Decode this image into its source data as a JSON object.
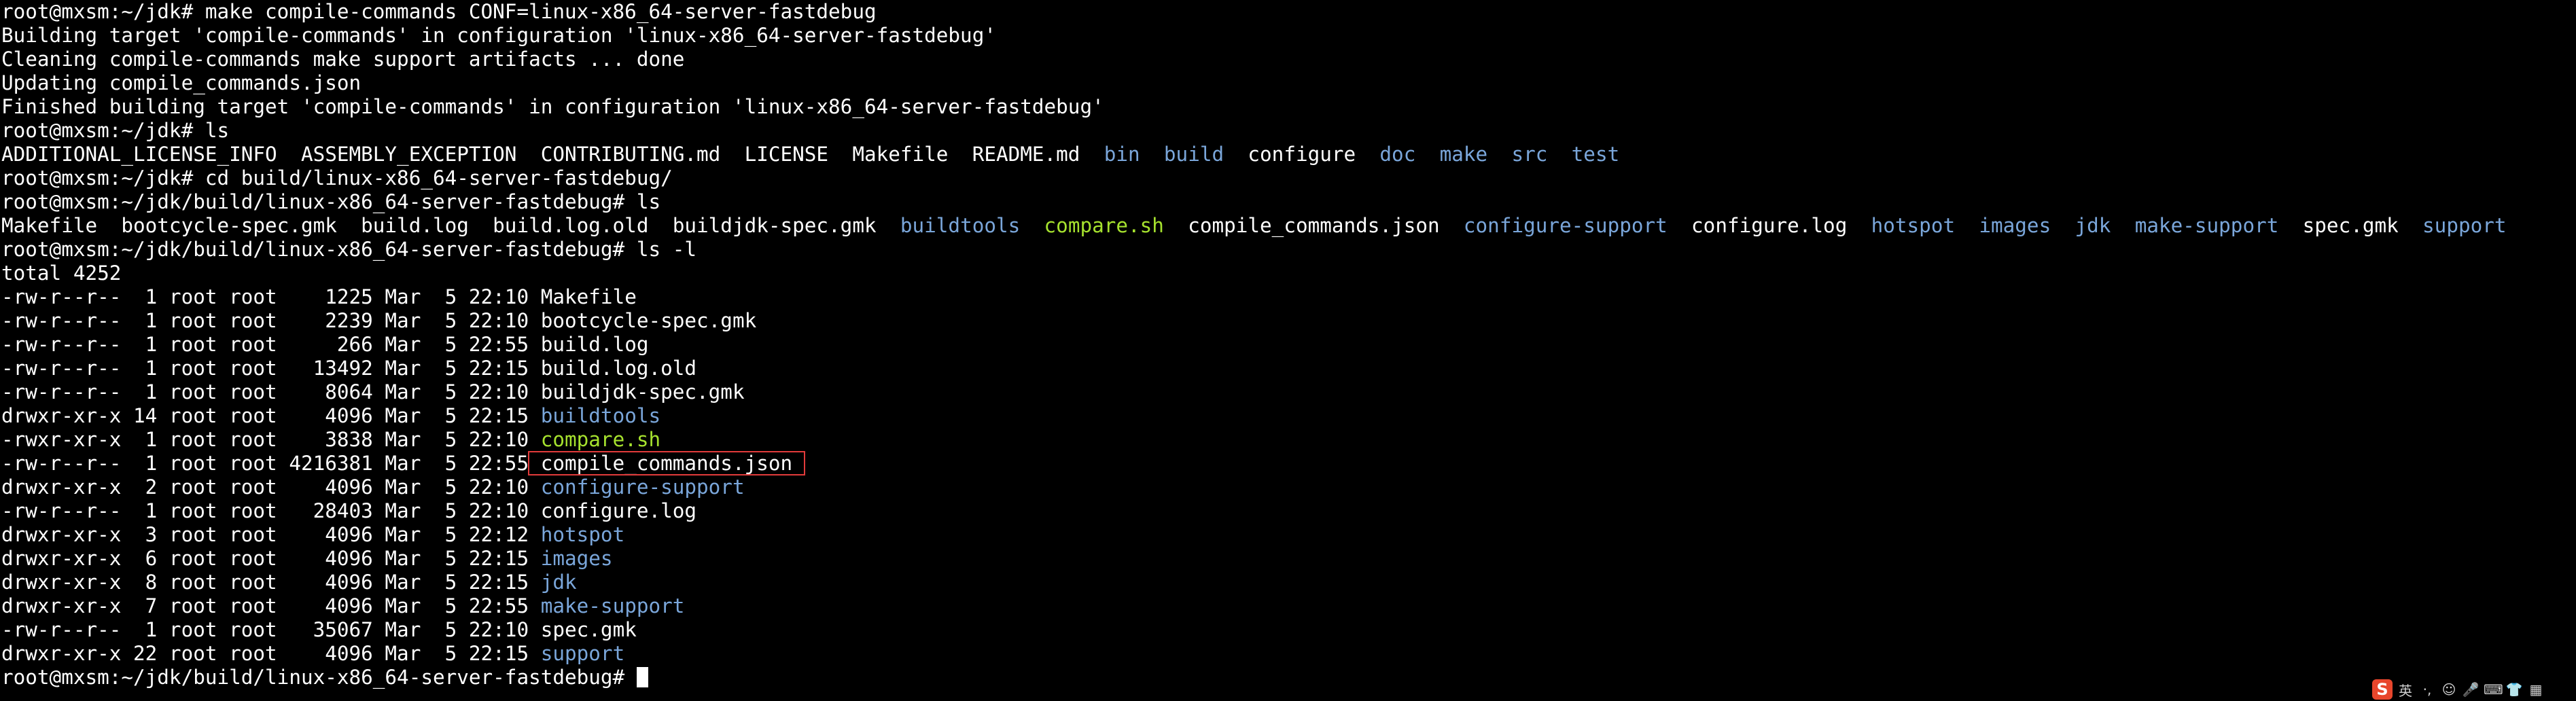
{
  "terminal": {
    "lines": [
      {
        "segments": [
          {
            "text": "root@mxsm:~/jdk# make compile-commands CONF=linux-x86_64-server-fastdebug",
            "kind": "plain"
          }
        ]
      },
      {
        "segments": [
          {
            "text": "Building target 'compile-commands' in configuration 'linux-x86_64-server-fastdebug'",
            "kind": "plain"
          }
        ]
      },
      {
        "segments": [
          {
            "text": "Cleaning compile-commands make support artifacts ... done",
            "kind": "plain"
          }
        ]
      },
      {
        "segments": [
          {
            "text": "Updating compile_commands.json",
            "kind": "plain"
          }
        ]
      },
      {
        "segments": [
          {
            "text": "Finished building target 'compile-commands' in configuration 'linux-x86_64-server-fastdebug'",
            "kind": "plain"
          }
        ]
      },
      {
        "segments": [
          {
            "text": "root@mxsm:~/jdk# ls",
            "kind": "plain"
          }
        ]
      },
      {
        "segments": [
          {
            "text": "ADDITIONAL_LICENSE_INFO  ASSEMBLY_EXCEPTION  CONTRIBUTING.md  LICENSE  Makefile  README.md  ",
            "kind": "plain"
          },
          {
            "text": "bin",
            "kind": "dir"
          },
          {
            "text": "  ",
            "kind": "plain"
          },
          {
            "text": "build",
            "kind": "dir"
          },
          {
            "text": "  configure  ",
            "kind": "plain"
          },
          {
            "text": "doc",
            "kind": "dir"
          },
          {
            "text": "  ",
            "kind": "plain"
          },
          {
            "text": "make",
            "kind": "dir"
          },
          {
            "text": "  ",
            "kind": "plain"
          },
          {
            "text": "src",
            "kind": "dir"
          },
          {
            "text": "  ",
            "kind": "plain"
          },
          {
            "text": "test",
            "kind": "dir"
          }
        ]
      },
      {
        "segments": [
          {
            "text": "root@mxsm:~/jdk# cd build/linux-x86_64-server-fastdebug/",
            "kind": "plain"
          }
        ]
      },
      {
        "segments": [
          {
            "text": "root@mxsm:~/jdk/build/linux-x86_64-server-fastdebug# ls",
            "kind": "plain"
          }
        ]
      },
      {
        "segments": [
          {
            "text": "Makefile  bootcycle-spec.gmk  build.log  build.log.old  buildjdk-spec.gmk  ",
            "kind": "plain"
          },
          {
            "text": "buildtools",
            "kind": "dir"
          },
          {
            "text": "  ",
            "kind": "plain"
          },
          {
            "text": "compare.sh",
            "kind": "exe"
          },
          {
            "text": "  compile_commands.json  ",
            "kind": "plain"
          },
          {
            "text": "configure-support",
            "kind": "dir"
          },
          {
            "text": "  configure.log  ",
            "kind": "plain"
          },
          {
            "text": "hotspot",
            "kind": "dir"
          },
          {
            "text": "  ",
            "kind": "plain"
          },
          {
            "text": "images",
            "kind": "dir"
          },
          {
            "text": "  ",
            "kind": "plain"
          },
          {
            "text": "jdk",
            "kind": "dir"
          },
          {
            "text": "  ",
            "kind": "plain"
          },
          {
            "text": "make-support",
            "kind": "dir"
          },
          {
            "text": "  spec.gmk  ",
            "kind": "plain"
          },
          {
            "text": "support",
            "kind": "dir"
          }
        ]
      },
      {
        "segments": [
          {
            "text": "root@mxsm:~/jdk/build/linux-x86_64-server-fastdebug# ls -l",
            "kind": "plain"
          }
        ]
      },
      {
        "segments": [
          {
            "text": "total 4252",
            "kind": "plain"
          }
        ]
      },
      {
        "segments": [
          {
            "text": "-rw-r--r--  1 root root    1225 Mar  5 22:10 ",
            "kind": "plain"
          },
          {
            "text": "Makefile",
            "kind": "plain"
          }
        ]
      },
      {
        "segments": [
          {
            "text": "-rw-r--r--  1 root root    2239 Mar  5 22:10 ",
            "kind": "plain"
          },
          {
            "text": "bootcycle-spec.gmk",
            "kind": "plain"
          }
        ]
      },
      {
        "segments": [
          {
            "text": "-rw-r--r--  1 root root     266 Mar  5 22:55 ",
            "kind": "plain"
          },
          {
            "text": "build.log",
            "kind": "plain"
          }
        ]
      },
      {
        "segments": [
          {
            "text": "-rw-r--r--  1 root root   13492 Mar  5 22:15 ",
            "kind": "plain"
          },
          {
            "text": "build.log.old",
            "kind": "plain"
          }
        ]
      },
      {
        "segments": [
          {
            "text": "-rw-r--r--  1 root root    8064 Mar  5 22:10 ",
            "kind": "plain"
          },
          {
            "text": "buildjdk-spec.gmk",
            "kind": "plain"
          }
        ]
      },
      {
        "segments": [
          {
            "text": "drwxr-xr-x 14 root root    4096 Mar  5 22:15 ",
            "kind": "plain"
          },
          {
            "text": "buildtools",
            "kind": "dir"
          }
        ]
      },
      {
        "segments": [
          {
            "text": "-rwxr-xr-x  1 root root    3838 Mar  5 22:10 ",
            "kind": "plain"
          },
          {
            "text": "compare.sh",
            "kind": "exe"
          }
        ]
      },
      {
        "segments": [
          {
            "text": "-rw-r--r--  1 root root 4216381 Mar  5 22:55",
            "kind": "plain"
          },
          {
            "text": " compile_commands.json ",
            "kind": "highlight"
          }
        ]
      },
      {
        "segments": [
          {
            "text": "drwxr-xr-x  2 root root    4096 Mar  5 22:10 ",
            "kind": "plain"
          },
          {
            "text": "configure-support",
            "kind": "dir"
          }
        ]
      },
      {
        "segments": [
          {
            "text": "-rw-r--r--  1 root root   28403 Mar  5 22:10 ",
            "kind": "plain"
          },
          {
            "text": "configure.log",
            "kind": "plain"
          }
        ]
      },
      {
        "segments": [
          {
            "text": "drwxr-xr-x  3 root root    4096 Mar  5 22:12 ",
            "kind": "plain"
          },
          {
            "text": "hotspot",
            "kind": "dir"
          }
        ]
      },
      {
        "segments": [
          {
            "text": "drwxr-xr-x  6 root root    4096 Mar  5 22:15 ",
            "kind": "plain"
          },
          {
            "text": "images",
            "kind": "dir"
          }
        ]
      },
      {
        "segments": [
          {
            "text": "drwxr-xr-x  8 root root    4096 Mar  5 22:15 ",
            "kind": "plain"
          },
          {
            "text": "jdk",
            "kind": "dir"
          }
        ]
      },
      {
        "segments": [
          {
            "text": "drwxr-xr-x  7 root root    4096 Mar  5 22:55 ",
            "kind": "plain"
          },
          {
            "text": "make-support",
            "kind": "dir"
          }
        ]
      },
      {
        "segments": [
          {
            "text": "-rw-r--r--  1 root root   35067 Mar  5 22:10 ",
            "kind": "plain"
          },
          {
            "text": "spec.gmk",
            "kind": "plain"
          }
        ]
      },
      {
        "segments": [
          {
            "text": "drwxr-xr-x 22 root root    4096 Mar  5 22:15 ",
            "kind": "plain"
          },
          {
            "text": "support",
            "kind": "dir"
          }
        ]
      },
      {
        "segments": [
          {
            "text": "root@mxsm:~/jdk/build/linux-x86_64-server-fastdebug# ",
            "kind": "plain"
          },
          {
            "text": "",
            "kind": "cursor"
          }
        ]
      }
    ]
  },
  "ime_toolbar": {
    "logo": "S",
    "mode": "英",
    "items": [
      {
        "label": "·,",
        "icon": "punctuation-icon"
      },
      {
        "label": "☺",
        "icon": "emoji-icon"
      },
      {
        "label": "🎤",
        "icon": "microphone-icon"
      },
      {
        "label": "⌨",
        "icon": "keyboard-icon"
      },
      {
        "label": "👕",
        "icon": "skin-icon"
      },
      {
        "label": "▦",
        "icon": "toolbox-icon"
      }
    ]
  },
  "colors": {
    "background": "#000000",
    "text": "#ffffff",
    "directory": "#7aa6da",
    "executable": "#a6e22e",
    "highlight_box": "#e23b3b",
    "ime_logo": "#e8462c"
  }
}
